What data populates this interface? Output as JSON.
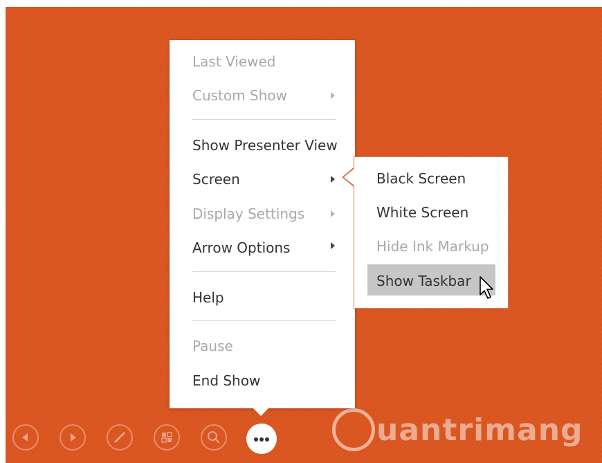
{
  "menu": {
    "items": [
      {
        "label": "Last Viewed",
        "enabled": false
      },
      {
        "label": "Custom Show",
        "enabled": false,
        "has_submenu": true
      },
      {
        "label": "Show Presenter View",
        "enabled": true
      },
      {
        "label": "Screen",
        "enabled": true,
        "has_submenu": true,
        "open": true
      },
      {
        "label": "Display Settings",
        "enabled": false,
        "has_submenu": true
      },
      {
        "label": "Arrow Options",
        "enabled": true,
        "has_submenu": true
      },
      {
        "label": "Help",
        "enabled": true
      },
      {
        "label": "Pause",
        "enabled": false
      },
      {
        "label": "End Show",
        "enabled": true
      }
    ]
  },
  "submenu": {
    "items": [
      {
        "label": "Black Screen",
        "enabled": true
      },
      {
        "label": "White Screen",
        "enabled": true
      },
      {
        "label": "Hide Ink Markup",
        "enabled": false
      },
      {
        "label": "Show Taskbar",
        "enabled": true,
        "highlighted": true
      }
    ]
  },
  "controls": [
    "previous-icon",
    "next-icon",
    "pen-icon",
    "all-slides-icon",
    "zoom-icon",
    "more-options-icon"
  ],
  "watermark": {
    "text": "uantrimang"
  },
  "colors": {
    "slide_bg": "#d9541e",
    "highlight": "#c6c6c6",
    "submenu_border": "#d97a56"
  }
}
